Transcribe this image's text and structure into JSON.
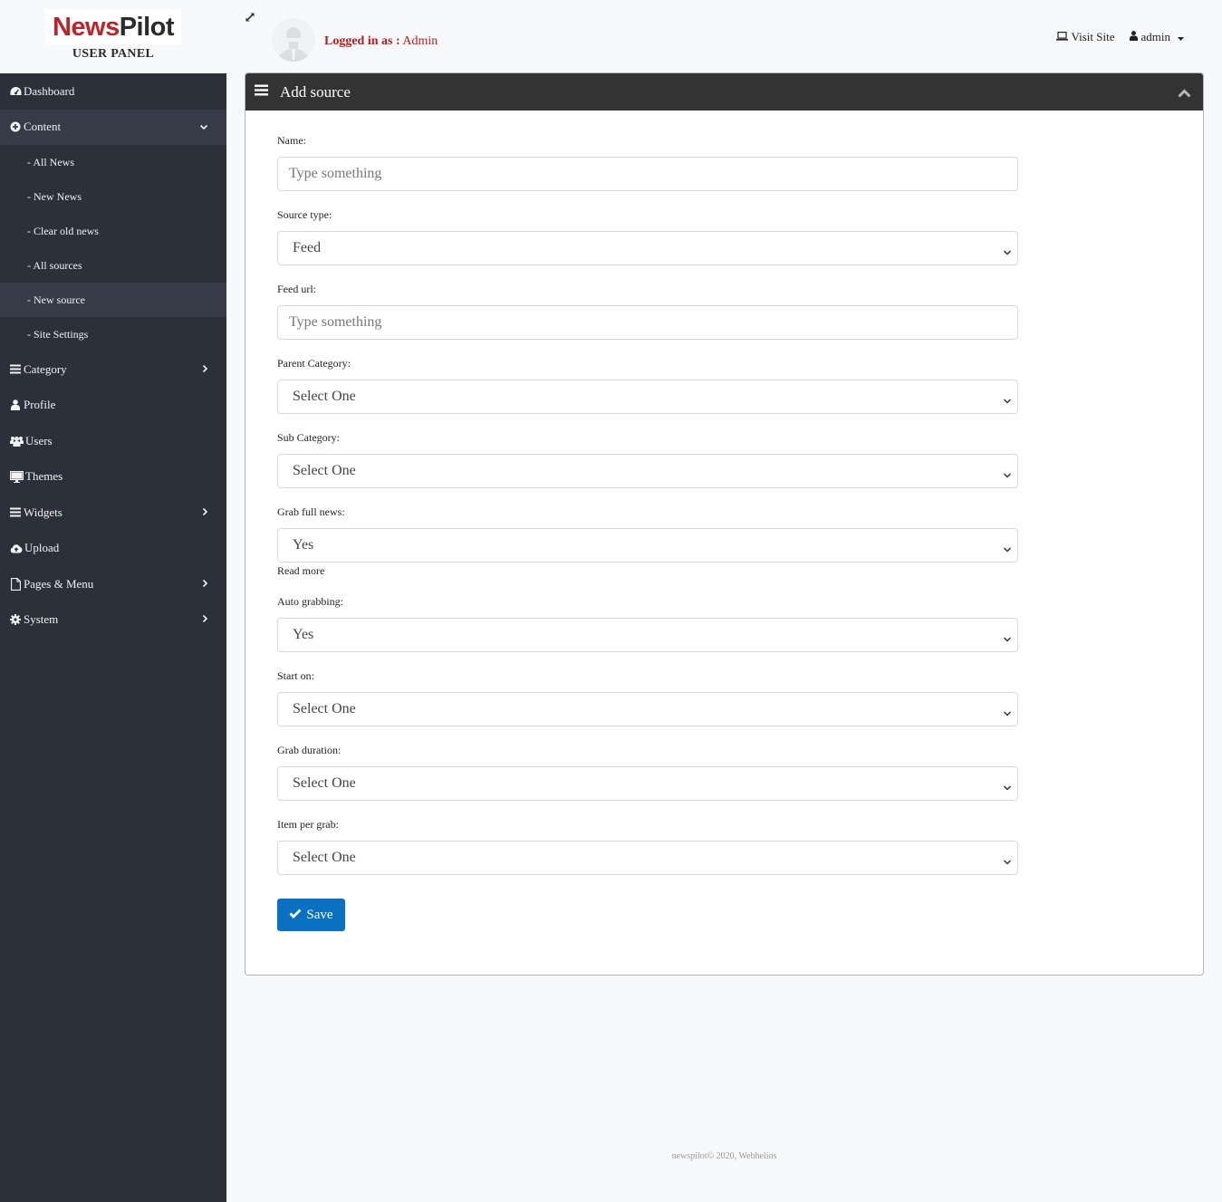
{
  "brand": {
    "part1": "News",
    "part2": "Pilot",
    "subtitle": "USER PANEL"
  },
  "sidebar": {
    "items": [
      {
        "label": "Dashboard",
        "icon": "dashboard-icon"
      },
      {
        "label": "Content",
        "icon": "plus-circle-icon",
        "expanded": true,
        "children": [
          {
            "label": "- All News"
          },
          {
            "label": "- New News"
          },
          {
            "label": "- Clear old news"
          },
          {
            "label": "- All sources"
          },
          {
            "label": "- New source",
            "active": true
          },
          {
            "label": "- Site Settings"
          }
        ]
      },
      {
        "label": "Category",
        "icon": "bars-icon",
        "has_children": true
      },
      {
        "label": "Profile",
        "icon": "user-icon"
      },
      {
        "label": "Users",
        "icon": "users-icon"
      },
      {
        "label": "Themes",
        "icon": "desktop-icon"
      },
      {
        "label": "Widgets",
        "icon": "bars-icon",
        "has_children": true
      },
      {
        "label": "Upload",
        "icon": "cloud-upload-icon"
      },
      {
        "label": "Pages & Menu",
        "icon": "file-icon",
        "has_children": true
      },
      {
        "label": "System",
        "icon": "gear-icon",
        "has_children": true
      }
    ]
  },
  "topbar": {
    "logged_prefix": "Logged in as :",
    "logged_user": "Admin",
    "visit_site": "Visit Site",
    "user_menu": "admin"
  },
  "card": {
    "title": "Add source",
    "fields": [
      {
        "label": "Name:",
        "type": "input",
        "placeholder": "Type something",
        "value": ""
      },
      {
        "label": "Source type:",
        "type": "select",
        "value": "Feed"
      },
      {
        "label": "Feed url:",
        "type": "input",
        "placeholder": "Type something",
        "value": ""
      },
      {
        "label": "Parent Category:",
        "type": "select",
        "value": "Select One"
      },
      {
        "label": "Sub Category:",
        "type": "select",
        "value": "Select One"
      },
      {
        "label": "Grab full news:",
        "type": "select",
        "value": "Yes",
        "help": "Read more"
      },
      {
        "label": "Auto grabbing:",
        "type": "select",
        "value": "Yes"
      },
      {
        "label": "Start on:",
        "type": "select",
        "value": "Select One"
      },
      {
        "label": "Grab duration:",
        "type": "select",
        "value": "Select One"
      },
      {
        "label": "Item per grab:",
        "type": "select",
        "value": "Select One"
      }
    ],
    "save_label": "Save"
  },
  "footer": {
    "text": "newspilot© 2020, Webhelios"
  },
  "colors": {
    "sidebar_bg": "#2c303b",
    "sidebar_active": "#363b47",
    "header_bg": "#333333",
    "primary": "#0a70c2",
    "brand_red": "#b8262b",
    "logged_red": "#b31c1c"
  }
}
